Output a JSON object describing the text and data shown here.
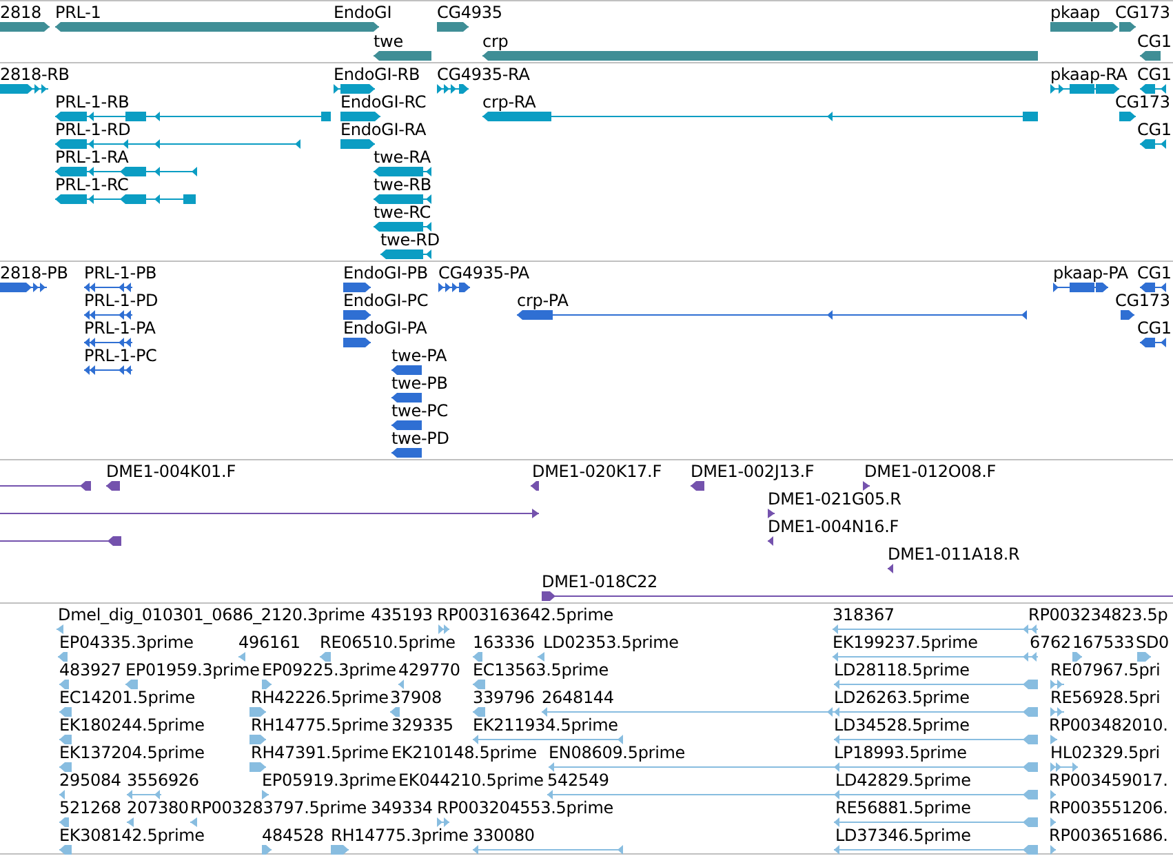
{
  "tracks": [
    {
      "color": "#3f8e96",
      "features": [
        {
          "label": "2818",
          "reverse": false
        },
        {
          "label": "PRL-1",
          "reverse": true
        },
        {
          "label": "EndoGI",
          "reverse": false
        },
        {
          "label": "CG4935",
          "reverse": false
        },
        {
          "label": "pkaap",
          "reverse": false
        },
        {
          "label": "CG173",
          "reverse": false
        },
        {
          "label": "twe",
          "reverse": true
        },
        {
          "label": "crp",
          "reverse": true
        },
        {
          "label": "CG1",
          "reverse": true
        }
      ]
    },
    {
      "color": "#0b9dc3",
      "features": [
        {
          "label": "2818-RB",
          "reverse": false
        },
        {
          "label": "EndoGI-RB",
          "reverse": false
        },
        {
          "label": "CG4935-RA",
          "reverse": false
        },
        {
          "label": "pkaap-RA",
          "reverse": false
        },
        {
          "label": "CG1",
          "reverse": true
        },
        {
          "label": "PRL-1-RB",
          "reverse": true
        },
        {
          "label": "EndoGI-RC",
          "reverse": false
        },
        {
          "label": "crp-RA",
          "reverse": true
        },
        {
          "label": "CG173",
          "reverse": false
        },
        {
          "label": "PRL-1-RD",
          "reverse": true
        },
        {
          "label": "EndoGI-RA",
          "reverse": false
        },
        {
          "label": "CG1",
          "reverse": true
        },
        {
          "label": "PRL-1-RA",
          "reverse": true
        },
        {
          "label": "twe-RA",
          "reverse": true
        },
        {
          "label": "PRL-1-RC",
          "reverse": true
        },
        {
          "label": "twe-RB",
          "reverse": true
        },
        {
          "label": "twe-RC",
          "reverse": true
        },
        {
          "label": "twe-RD",
          "reverse": true
        }
      ]
    },
    {
      "color": "#2f6fd3",
      "features": [
        {
          "label": "2818-PB",
          "reverse": false
        },
        {
          "label": "PRL-1-PB",
          "reverse": true
        },
        {
          "label": "EndoGI-PB",
          "reverse": false
        },
        {
          "label": "CG4935-PA",
          "reverse": false
        },
        {
          "label": "pkaap-PA",
          "reverse": false
        },
        {
          "label": "CG1",
          "reverse": true
        },
        {
          "label": "PRL-1-PD",
          "reverse": true
        },
        {
          "label": "EndoGI-PC",
          "reverse": false
        },
        {
          "label": "crp-PA",
          "reverse": true
        },
        {
          "label": "CG173",
          "reverse": false
        },
        {
          "label": "PRL-1-PA",
          "reverse": true
        },
        {
          "label": "EndoGI-PA",
          "reverse": false
        },
        {
          "label": "CG1",
          "reverse": true
        },
        {
          "label": "PRL-1-PC",
          "reverse": true
        },
        {
          "label": "twe-PA",
          "reverse": true
        },
        {
          "label": "twe-PB",
          "reverse": true
        },
        {
          "label": "twe-PC",
          "reverse": true
        },
        {
          "label": "twe-PD",
          "reverse": true
        }
      ]
    },
    {
      "color": "#7452ad",
      "features": [
        {
          "reverse": true
        },
        {
          "label": "DME1-004K01.F",
          "reverse": true
        },
        {
          "label": "DME1-020K17.F",
          "reverse": true
        },
        {
          "label": "DME1-002J13.F",
          "reverse": true
        },
        {
          "label": "DME1-012O08.F",
          "reverse": false
        },
        {
          "reverse": false
        },
        {
          "label": "DME1-021G05.R",
          "reverse": false
        },
        {
          "reverse": true
        },
        {
          "label": "DME1-004N16.F",
          "reverse": true
        },
        {
          "label": "DME1-011A18.R",
          "reverse": true
        },
        {
          "label": "DME1-018C22",
          "reverse": false
        }
      ]
    },
    {
      "color": "#88bde0",
      "features": [
        {
          "label": "Dmel_dig_010301_0686_2120.3prime",
          "reverse": true
        },
        {
          "label": "435193"
        },
        {
          "label": "RP003163642.5prime",
          "reverse": false
        },
        {
          "label": "318367",
          "reverse": true
        },
        {
          "label": "RP003234823.5p"
        },
        {
          "label": "EP04335.3prime",
          "reverse": true
        },
        {
          "label": "496161",
          "reverse": true
        },
        {
          "label": "RE06510.5prime",
          "reverse": true
        },
        {
          "label": "163336",
          "reverse": true
        },
        {
          "label": "LD02353.5prime",
          "reverse": true
        },
        {
          "label": "EK199237.5prime",
          "reverse": true
        },
        {
          "label": "6762"
        },
        {
          "label": "167533",
          "reverse": false
        },
        {
          "label": "SD0",
          "reverse": false
        },
        {
          "label": "483927",
          "reverse": true
        },
        {
          "label": "EP01959.3prime",
          "reverse": true
        },
        {
          "label": "EP09225.3prime",
          "reverse": false
        },
        {
          "label": "429770",
          "reverse": true
        },
        {
          "label": "EC13563.5prime",
          "reverse": true
        },
        {
          "label": "LD28118.5prime",
          "reverse": true
        },
        {
          "label": "RE07967.5pri",
          "reverse": false
        },
        {
          "label": "EC14201.5prime",
          "reverse": true
        },
        {
          "label": "RH42226.5prime",
          "reverse": false
        },
        {
          "label": "37908",
          "reverse": true
        },
        {
          "label": "339796",
          "reverse": true
        },
        {
          "label": "2648144",
          "reverse": true
        },
        {
          "label": "LD26263.5prime",
          "reverse": true
        },
        {
          "label": "RE56928.5pri",
          "reverse": false
        },
        {
          "label": "EK180244.5prime",
          "reverse": true
        },
        {
          "label": "RH14775.5prime",
          "reverse": false
        },
        {
          "label": "329335"
        },
        {
          "label": "EK211934.5prime",
          "reverse": true
        },
        {
          "label": "LD34528.5prime",
          "reverse": true
        },
        {
          "label": "RP003482010.",
          "reverse": false
        },
        {
          "label": "EK137204.5prime",
          "reverse": true
        },
        {
          "label": "RH47391.5prime",
          "reverse": false
        },
        {
          "label": "EK210148.5prime"
        },
        {
          "label": "EN08609.5prime",
          "reverse": true
        },
        {
          "label": "LP18993.5prime",
          "reverse": true
        },
        {
          "label": "HL02329.5pri",
          "reverse": false
        },
        {
          "label": "295084",
          "reverse": true
        },
        {
          "label": "3556926",
          "reverse": true
        },
        {
          "label": "EP05919.3prime",
          "reverse": false
        },
        {
          "label": "EK044210.5prime"
        },
        {
          "label": "542549",
          "reverse": true
        },
        {
          "label": "LD42829.5prime",
          "reverse": true
        },
        {
          "label": "RP003459017.",
          "reverse": false
        },
        {
          "label": "521268",
          "reverse": true
        },
        {
          "label": "207380",
          "reverse": true
        },
        {
          "label": "RP003283797.5prime",
          "reverse": true
        },
        {
          "label": "349334"
        },
        {
          "label": "RP003204553.5prime",
          "reverse": false
        },
        {
          "label": "RE56881.5prime",
          "reverse": true
        },
        {
          "label": "RP003551206.",
          "reverse": false
        },
        {
          "label": "EK308142.5prime",
          "reverse": true
        },
        {
          "label": "484528",
          "reverse": false
        },
        {
          "label": "RH14775.3prime",
          "reverse": false
        },
        {
          "label": "330080",
          "reverse": true
        },
        {
          "label": "LD37346.5prime",
          "reverse": true
        },
        {
          "label": "RP003651686.",
          "reverse": false
        }
      ]
    }
  ]
}
